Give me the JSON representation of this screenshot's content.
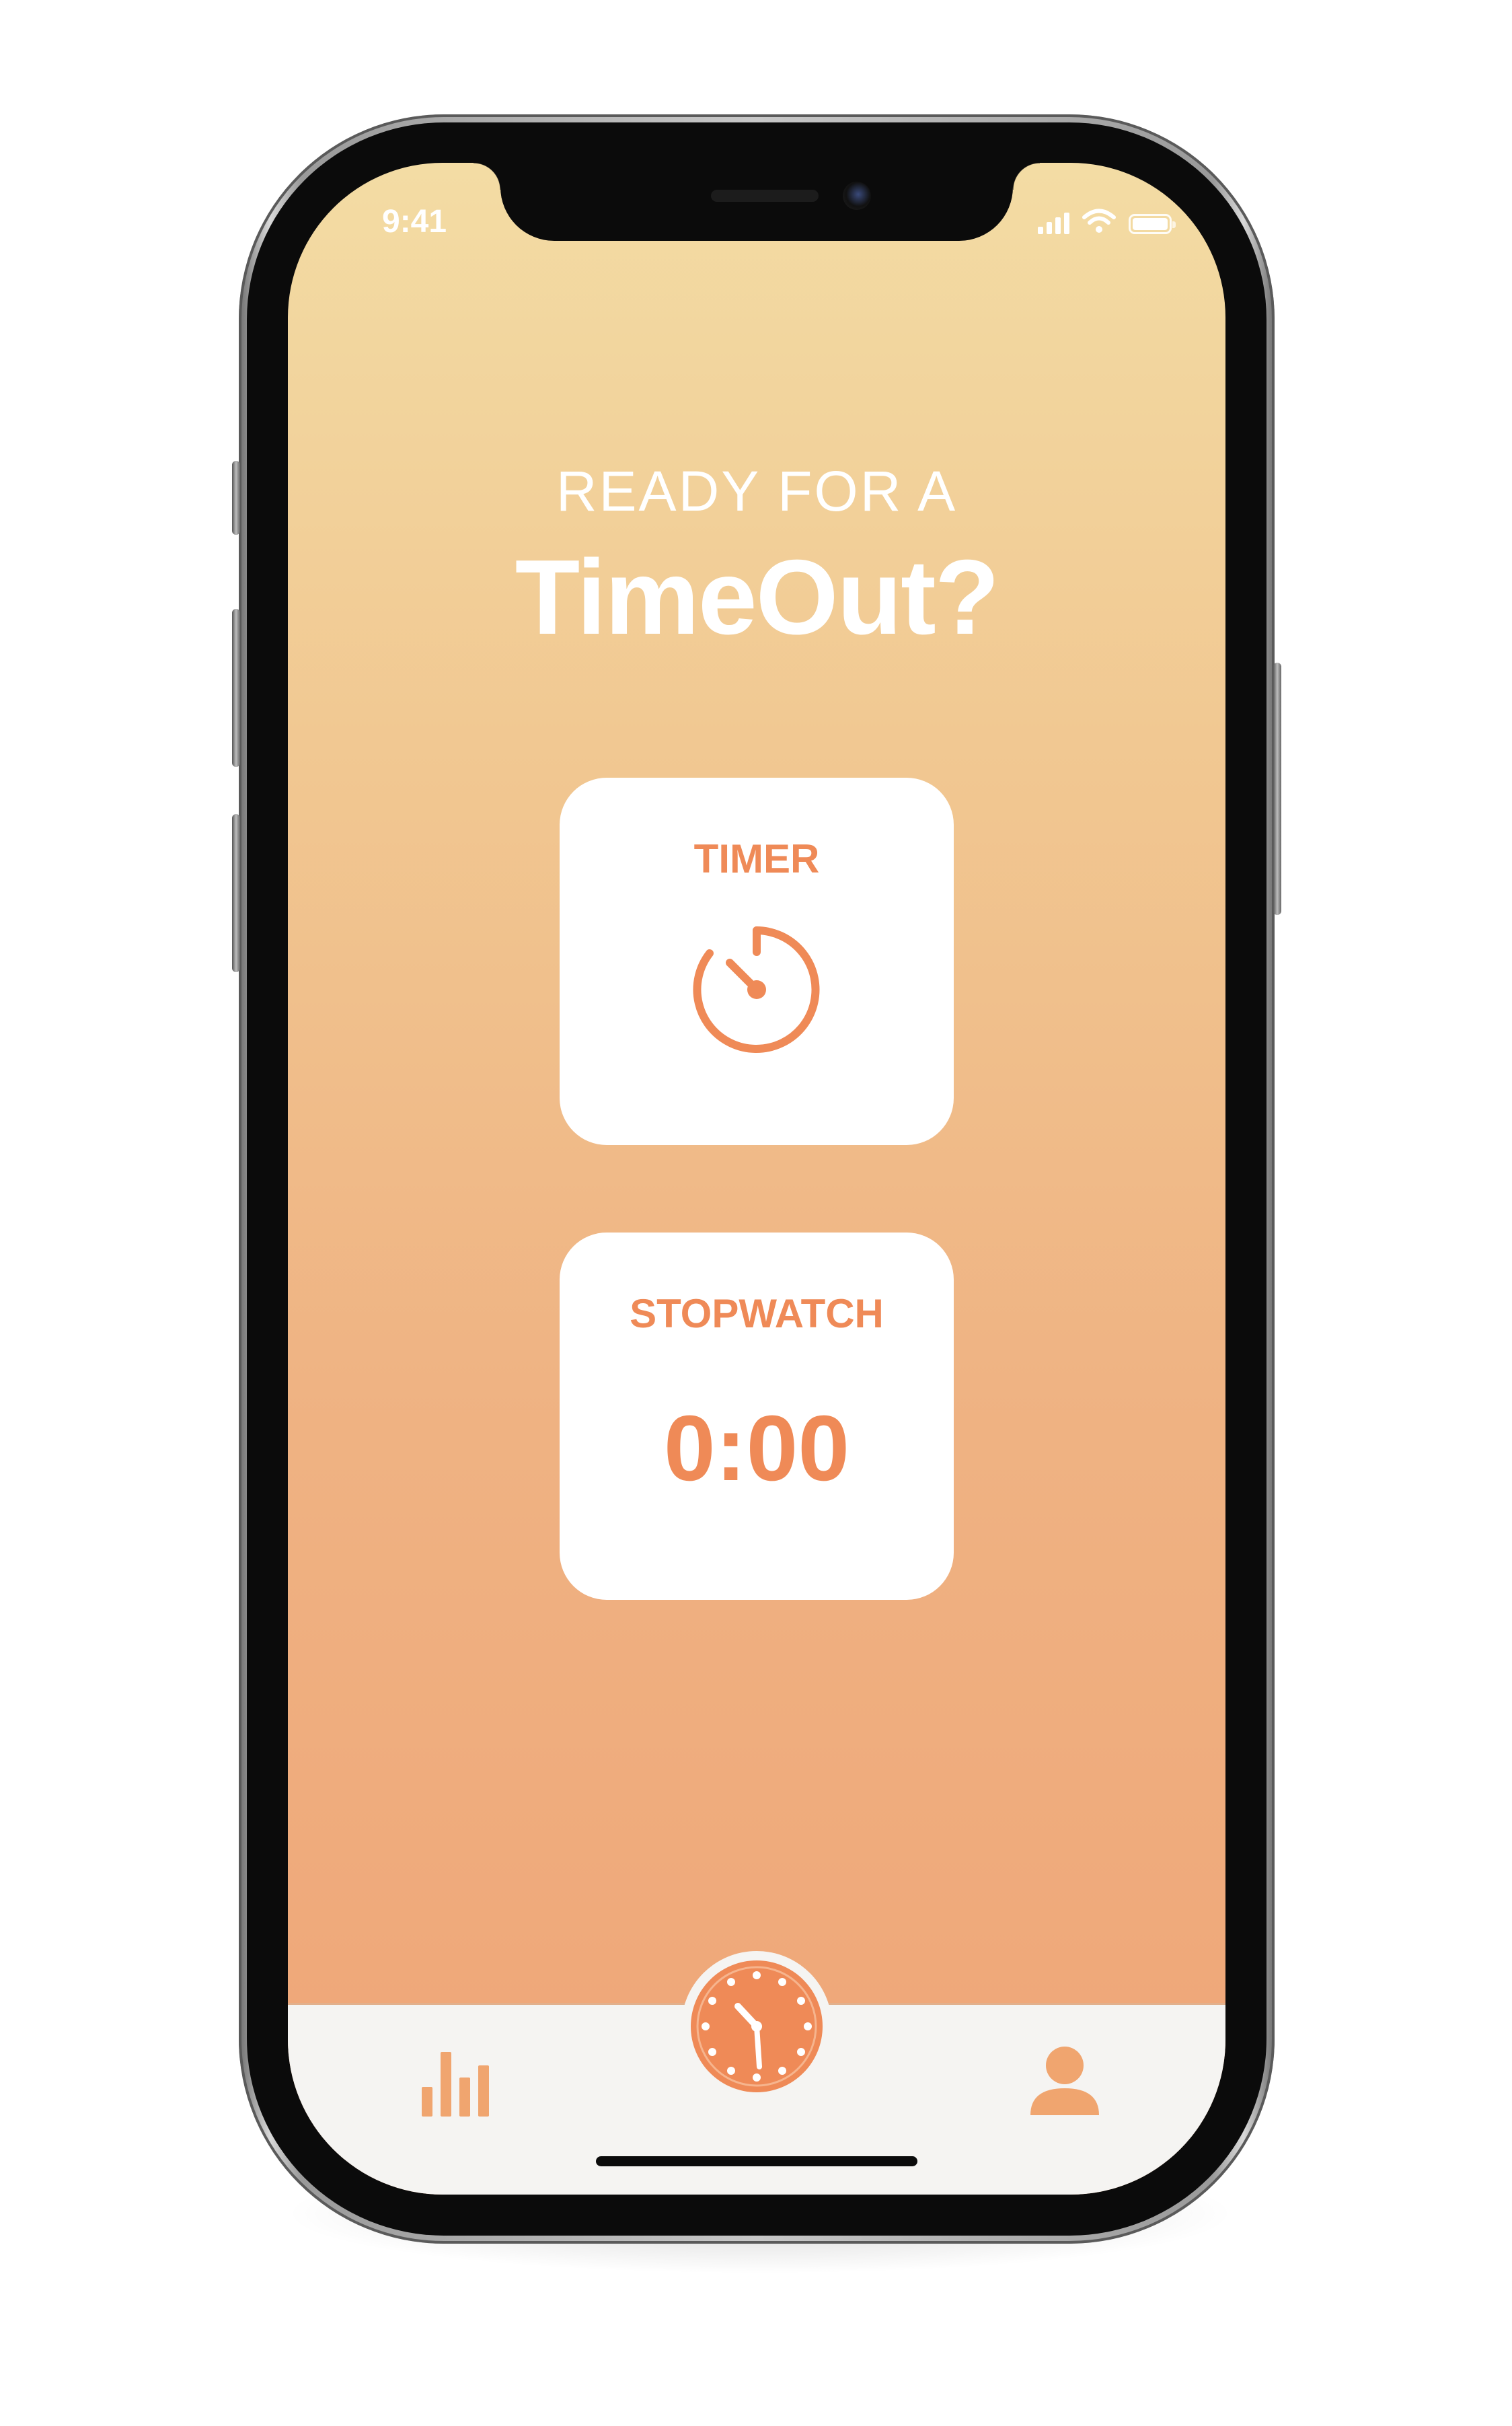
{
  "status_bar": {
    "time": "9:41",
    "icons": [
      "cellular-signal-icon",
      "wifi-icon",
      "battery-icon"
    ]
  },
  "main": {
    "subtitle": "READY FOR A",
    "title": "TimeOut?"
  },
  "cards": {
    "timer": {
      "label": "TIMER",
      "icon": "timer-icon"
    },
    "stopwatch": {
      "label": "STOPWATCH",
      "value": "0:00"
    }
  },
  "tab_bar": {
    "items": [
      {
        "name": "stats",
        "icon": "bar-chart-icon"
      },
      {
        "name": "clock",
        "icon": "clock-icon"
      },
      {
        "name": "profile",
        "icon": "user-icon"
      }
    ]
  },
  "colors": {
    "accent": "#ef8a57",
    "gradient_top": "#f3dca4",
    "gradient_bottom": "#efa577",
    "card_background": "#ffffff",
    "tab_bar_background": "#f5f4f2"
  }
}
